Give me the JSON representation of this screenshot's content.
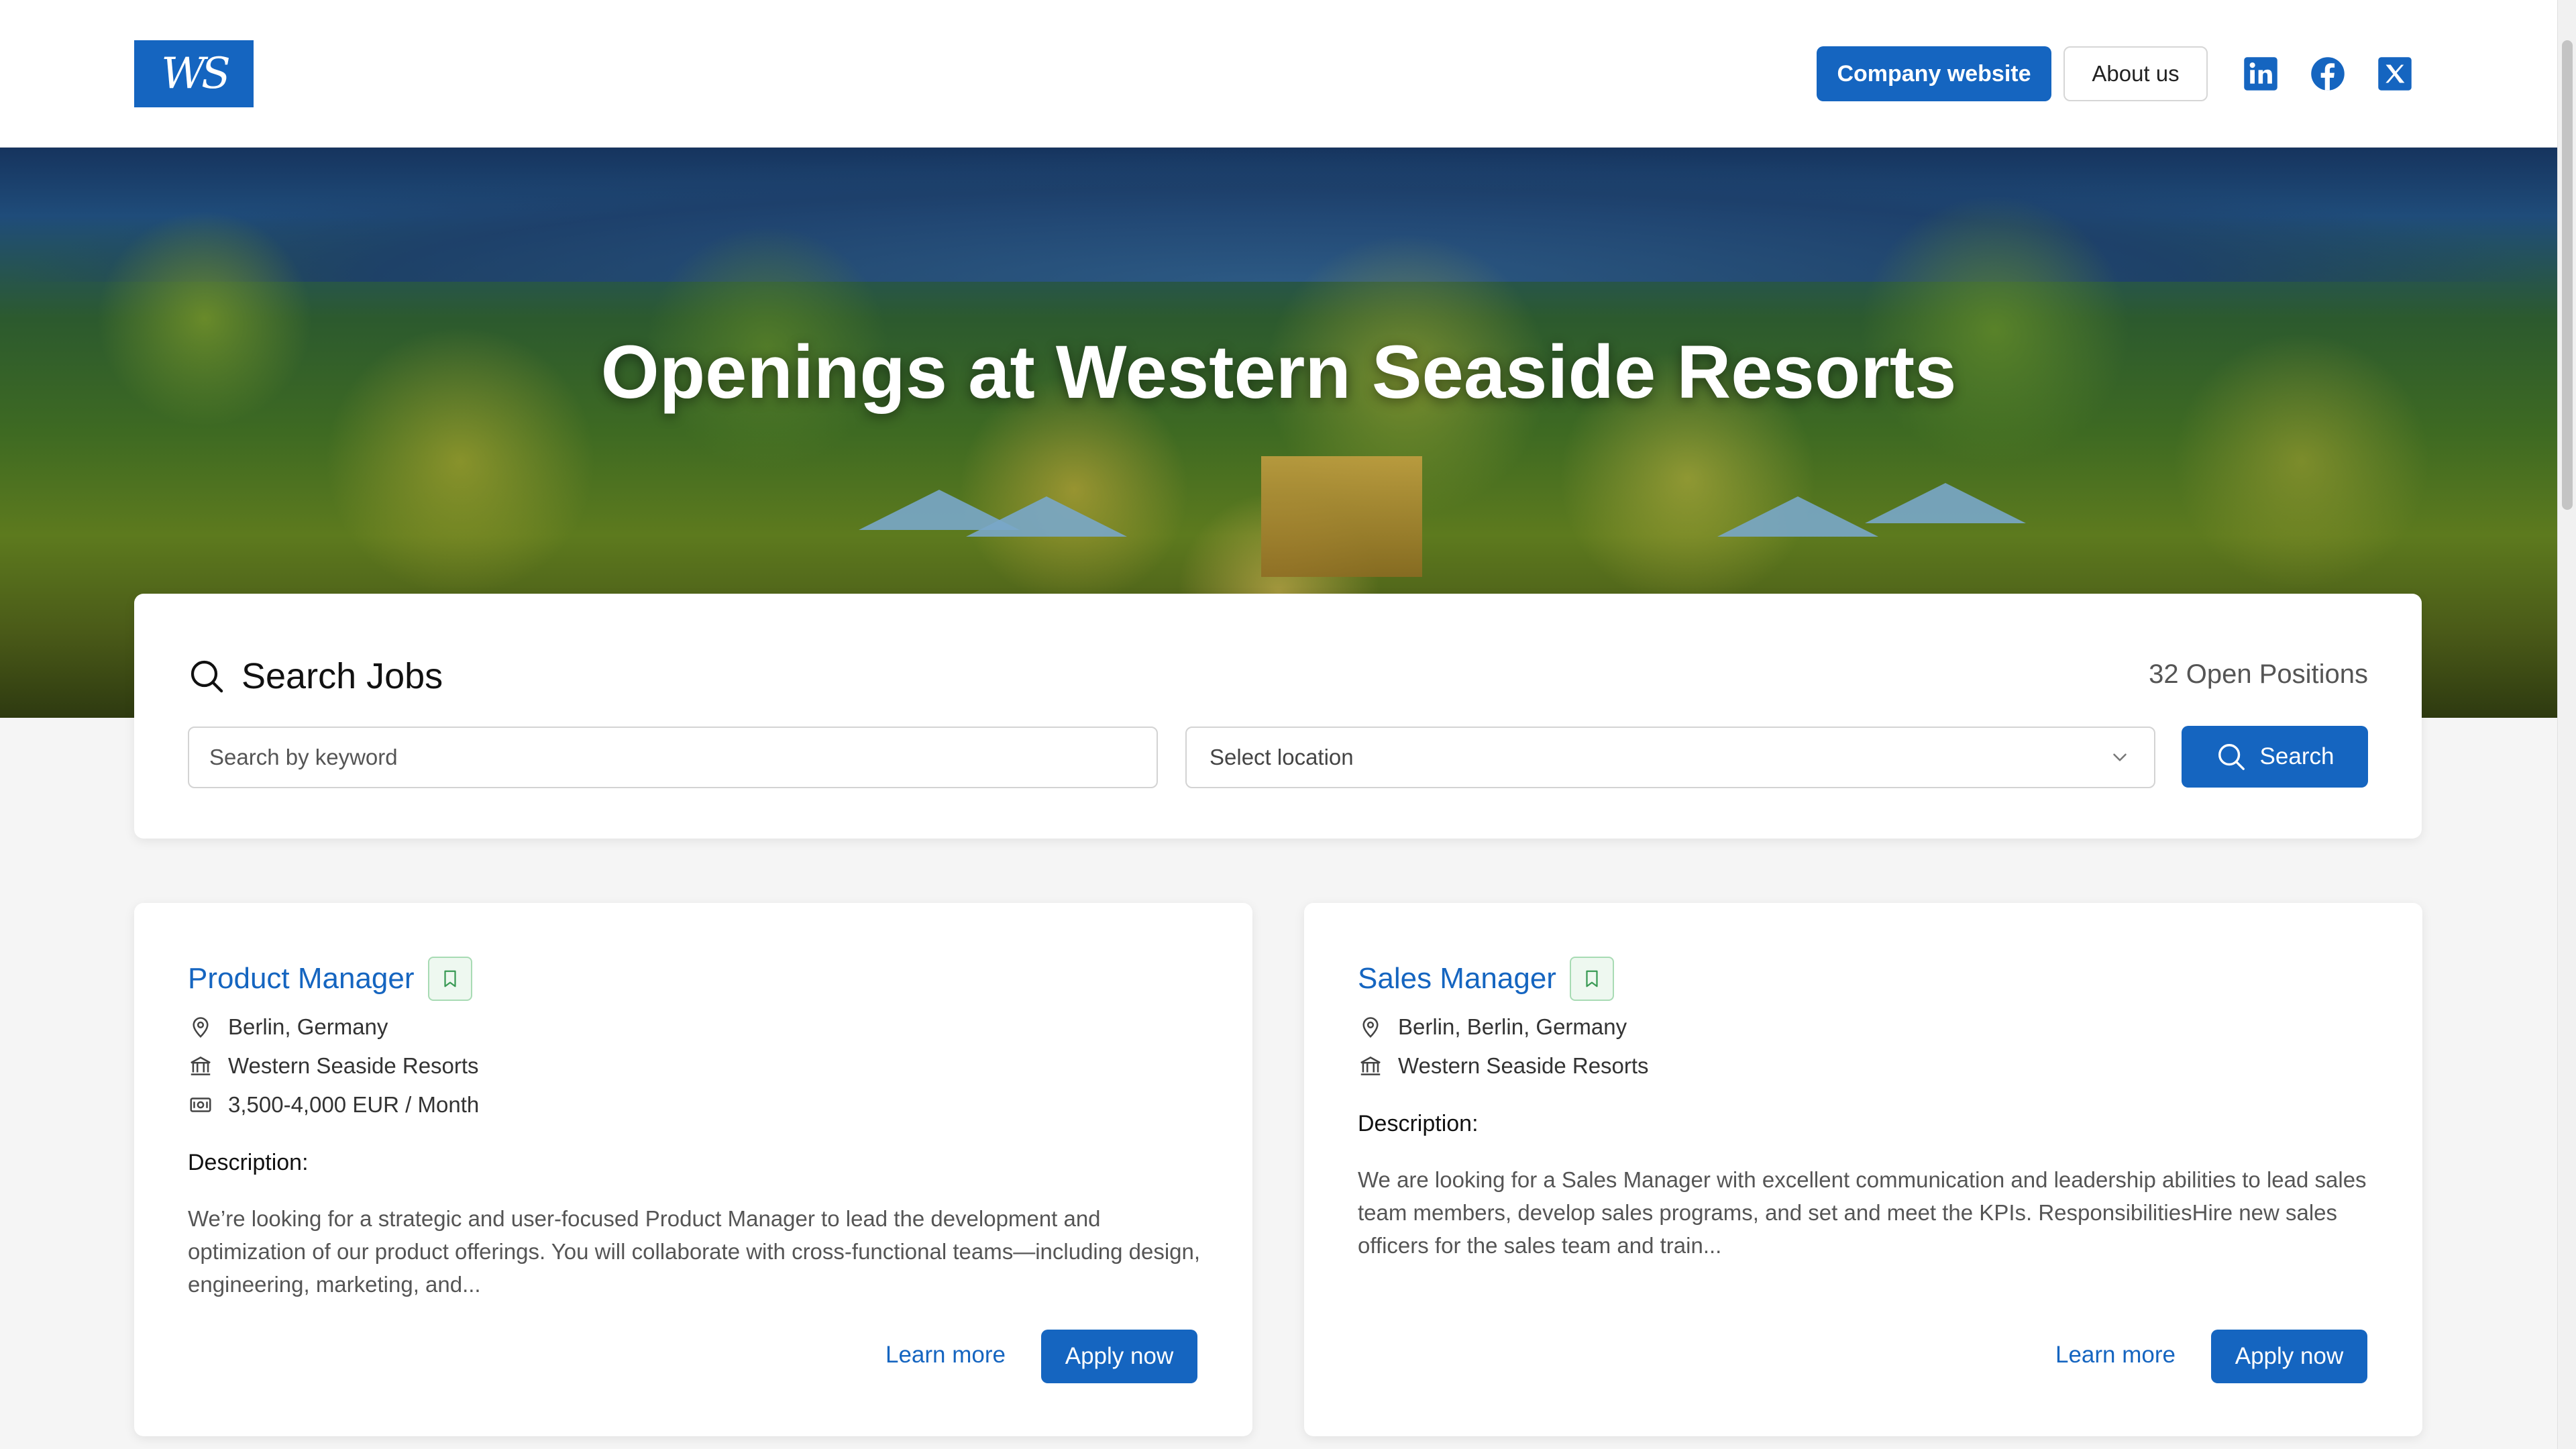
{
  "header": {
    "logo_text": "WS",
    "company_website_label": "Company website",
    "about_us_label": "About us",
    "social_icons": [
      "linkedin-icon",
      "facebook-icon",
      "x-icon"
    ]
  },
  "hero": {
    "title": "Openings at Western Seaside Resorts"
  },
  "search": {
    "heading": "Search Jobs",
    "open_positions": "32 Open Positions",
    "keyword_placeholder": "Search by keyword",
    "location_placeholder": "Select location",
    "search_button_label": "Search"
  },
  "jobs": [
    {
      "title": "Product Manager",
      "location": "Berlin, Germany",
      "company": "Western Seaside Resorts",
      "salary": "3,500-4,000 EUR / Month",
      "description_label": "Description:",
      "description": "We’re looking for a strategic and user-focused Product Manager to lead the development and optimization of our product offerings. You will collaborate with cross-functional teams—including design, engineering, marketing, and...",
      "learn_more_label": "Learn more",
      "apply_label": "Apply now"
    },
    {
      "title": "Sales Manager",
      "location": "Berlin, Berlin, Germany",
      "company": "Western Seaside Resorts",
      "description_label": "Description:",
      "description": "We are looking for a Sales Manager with excellent communication and leadership abilities to lead sales team members, develop sales programs, and set and meet the KPIs. ResponsibilitiesHire new sales officers for the sales team and train...",
      "learn_more_label": "Learn more",
      "apply_label": "Apply now"
    }
  ],
  "colors": {
    "accent": "#1565c0",
    "background": "#f5f5f5",
    "card": "#ffffff",
    "bookmark_border": "#a8dbb4"
  }
}
